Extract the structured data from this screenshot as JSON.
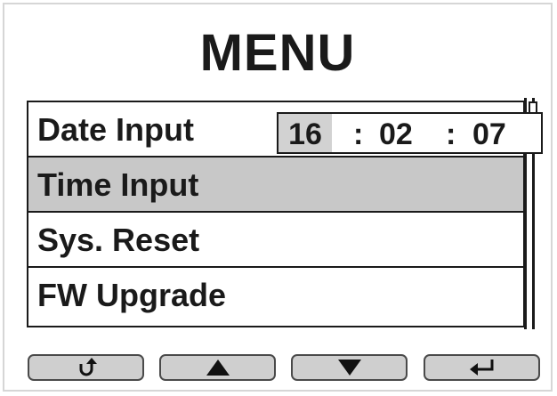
{
  "title": "MENU",
  "menu": {
    "items": [
      {
        "label": "Date Input"
      },
      {
        "label": "Time Input"
      },
      {
        "label": "Sys. Reset"
      },
      {
        "label": "FW Upgrade"
      }
    ],
    "selected_index": 1
  },
  "time_field": {
    "hour": "16",
    "sep1": ":",
    "minute": "02",
    "sep2": ":",
    "second": "07"
  },
  "buttons": [
    {
      "icon": "back-icon"
    },
    {
      "icon": "arrow-up-icon"
    },
    {
      "icon": "arrow-down-icon"
    },
    {
      "icon": "enter-icon"
    }
  ],
  "colors": {
    "selected_row": "#c8c8c8",
    "button_fill": "#cfcfcf",
    "text": "#1a1a1a"
  }
}
